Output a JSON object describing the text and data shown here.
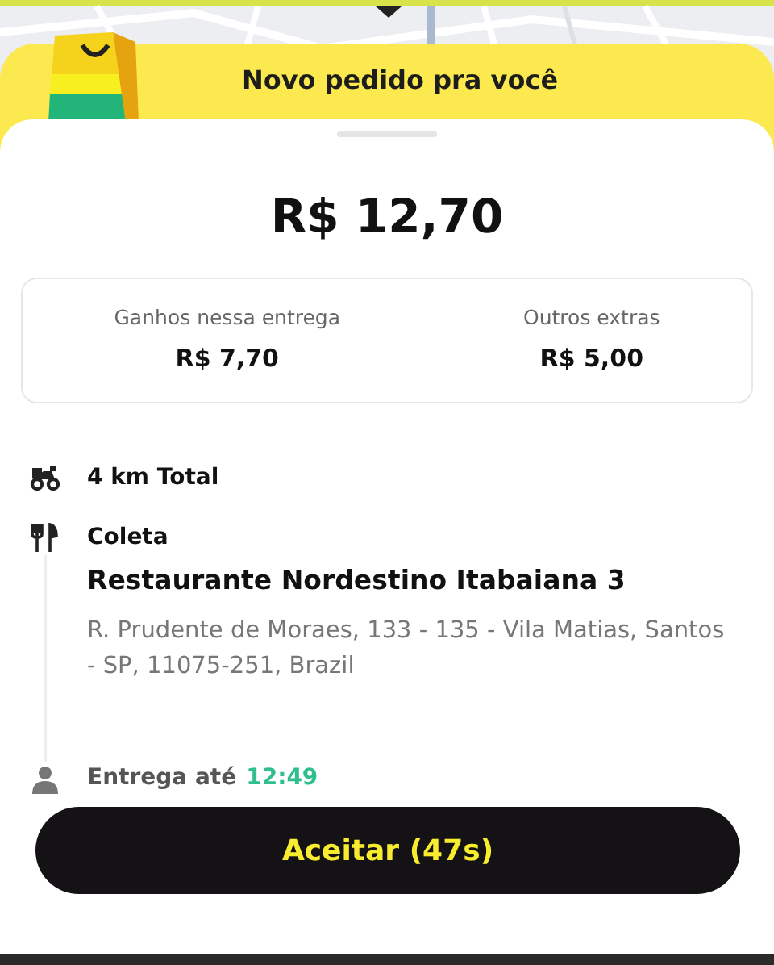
{
  "header": {
    "title": "Novo pedido pra você"
  },
  "total": "R$ 12,70",
  "breakdown": [
    {
      "label": "Ganhos nessa entrega",
      "value": "R$ 7,70"
    },
    {
      "label": "Outros extras",
      "value": "R$ 5,00"
    }
  ],
  "route": [
    {
      "kind": "distance",
      "text": "4 km Total"
    },
    {
      "kind": "pickup",
      "label": "Coleta",
      "name": "Restaurante Nordestino Itabaiana 3",
      "address": "R. Prudente de Moraes, 133 - 135 - Vila Matias, Santos - SP, 11075-251, Brazil"
    },
    {
      "kind": "delivery",
      "label": "Entrega até",
      "time": "12:49"
    }
  ],
  "accept_button": "Aceitar (47s)"
}
